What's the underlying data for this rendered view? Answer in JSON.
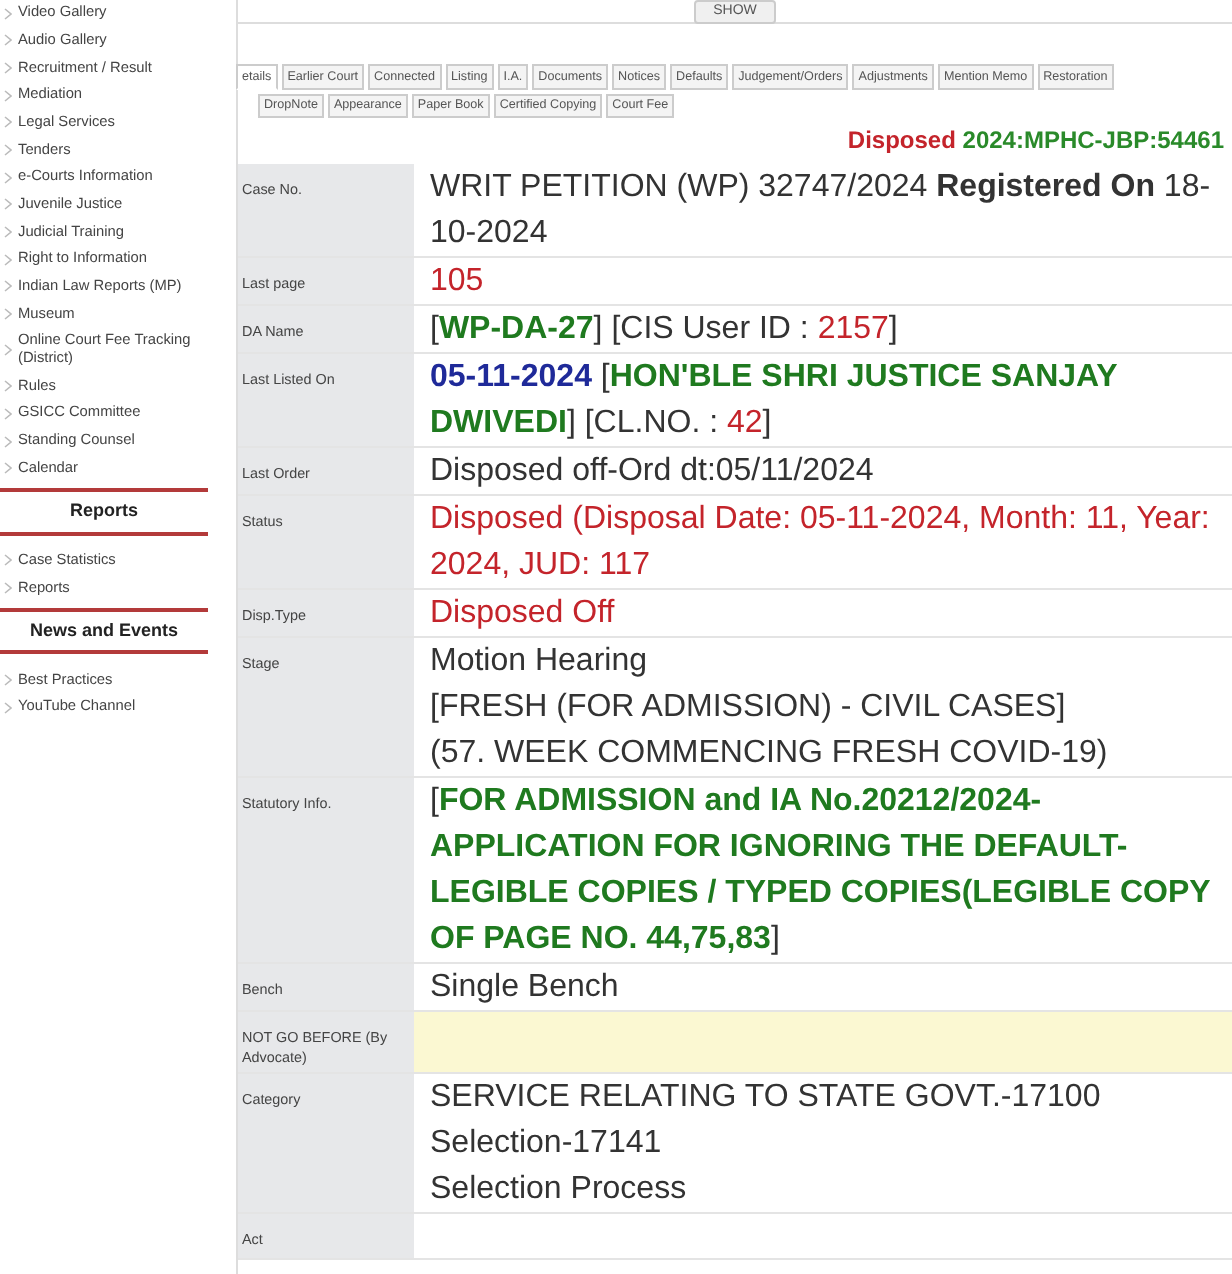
{
  "sidebar": {
    "sections": [
      {
        "items": [
          "Video Gallery",
          "Audio Gallery",
          "Recruitment / Result",
          "Mediation",
          "Legal Services",
          "Tenders",
          "e-Courts Information",
          "Juvenile Justice",
          "Judicial Training",
          "Right to Information",
          "Indian Law Reports (MP)",
          "Museum",
          "Online Court Fee Tracking (District)",
          "Rules",
          "GSICC Committee",
          "Standing Counsel",
          "Calendar"
        ]
      },
      {
        "heading": "Reports",
        "items": [
          "Case Statistics",
          "Reports"
        ]
      },
      {
        "heading": "News and Events",
        "items": [
          "Best Practices",
          "YouTube Channel"
        ]
      }
    ]
  },
  "show_button": "SHOW",
  "tabs": [
    {
      "label": "etails",
      "selected": true
    },
    {
      "label": "Earlier Court",
      "selected": false
    },
    {
      "label": "Connected",
      "selected": false
    },
    {
      "label": "Listing",
      "selected": false
    },
    {
      "label": "I.A.",
      "selected": false
    },
    {
      "label": "Documents",
      "selected": false
    },
    {
      "label": "Notices",
      "selected": false
    },
    {
      "label": "Defaults",
      "selected": false
    },
    {
      "label": "Judgement/Orders",
      "selected": false
    },
    {
      "label": "Adjustments",
      "selected": false
    },
    {
      "label": "Mention Memo",
      "selected": false
    },
    {
      "label": "Restoration",
      "selected": false
    },
    {
      "label": "DropNote",
      "selected": false
    },
    {
      "label": "Appearance",
      "selected": false
    },
    {
      "label": "Paper Book",
      "selected": false
    },
    {
      "label": "Certified Copying",
      "selected": false
    },
    {
      "label": "Court Fee",
      "selected": false
    }
  ],
  "case_header": [
    {
      "text": "Disposed",
      "color": "#c4242b"
    },
    {
      "text": "2024:MPHC-JBP:54461",
      "color": "#2a8a2a"
    }
  ],
  "details": [
    {
      "label": "Case No.",
      "highlighted": false,
      "lines": [
        [
          {
            "text": "WRIT PETITION (WP) 32747/2024 **Registered On** 18-10-2024",
            "color": "#333333",
            "bold": false
          }
        ]
      ]
    },
    {
      "label": "Last page",
      "highlighted": false,
      "lines": [
        [
          {
            "text": "105",
            "color": "#c4242b",
            "bold": false
          }
        ]
      ]
    },
    {
      "label": "DA Name",
      "highlighted": false,
      "lines": [
        [
          {
            "text": "[",
            "color": "#333333",
            "bold": false
          },
          {
            "text": "WP-DA-27",
            "color": "#1f7a1f",
            "bold": true
          },
          {
            "text": "] [CIS User ID : ",
            "color": "#333333",
            "bold": false
          },
          {
            "text": "2157",
            "color": "#c4242b",
            "bold": false
          },
          {
            "text": "]",
            "color": "#333333",
            "bold": false
          }
        ]
      ]
    },
    {
      "label": "Last Listed On",
      "highlighted": false,
      "lines": [
        [
          {
            "text": "05-11-2024",
            "color": "#1f2a99",
            "bold": true
          },
          {
            "text": " [",
            "color": "#333333",
            "bold": false
          },
          {
            "text": "HON'BLE SHRI JUSTICE SANJAY DWIVEDI",
            "color": "#1f7a1f",
            "bold": true
          },
          {
            "text": "] [CL.NO. : ",
            "color": "#333333",
            "bold": false
          },
          {
            "text": "42",
            "color": "#c4242b",
            "bold": false
          },
          {
            "text": "]",
            "color": "#333333",
            "bold": false
          }
        ]
      ]
    },
    {
      "label": "Last Order",
      "highlighted": false,
      "lines": [
        [
          {
            "text": "Disposed off-Ord dt:05/11/2024",
            "color": "#333333",
            "bold": false
          }
        ]
      ]
    },
    {
      "label": "Status",
      "highlighted": false,
      "lines": [
        [
          {
            "text": "Disposed (Disposal Date: 05-11-2024, Month: 11, Year: 2024, JUD: 117",
            "color": "#c4242b",
            "bold": false
          }
        ]
      ]
    },
    {
      "label": "Disp.Type",
      "highlighted": false,
      "lines": [
        [
          {
            "text": "Disposed Off",
            "color": "#c4242b",
            "bold": false
          }
        ]
      ]
    },
    {
      "label": "Stage",
      "highlighted": false,
      "lines": [
        [
          {
            "text": "Motion Hearing",
            "color": "#333333",
            "bold": false
          }
        ],
        [
          {
            "text": "[FRESH (FOR ADMISSION) - CIVIL CASES]",
            "color": "#333333",
            "bold": false
          }
        ],
        [
          {
            "text": "(57. WEEK COMMENCING FRESH COVID-19)",
            "color": "#333333",
            "bold": false
          }
        ]
      ]
    },
    {
      "label": "Statutory Info.",
      "highlighted": false,
      "lines": [
        [
          {
            "text": "[",
            "color": "#333333",
            "bold": false
          },
          {
            "text": "FOR ADMISSION and IA No.20212/2024-APPLICATION FOR IGNORING THE DEFAULT-LEGIBLE COPIES / TYPED COPIES(LEGIBLE COPY OF PAGE NO. 44,75,83",
            "color": "#1f7a1f",
            "bold": true
          },
          {
            "text": "]",
            "color": "#333333",
            "bold": false
          }
        ]
      ]
    },
    {
      "label": "Bench",
      "highlighted": false,
      "lines": [
        [
          {
            "text": "Single Bench",
            "color": "#333333",
            "bold": false
          }
        ]
      ]
    },
    {
      "label": "NOT GO BEFORE (By Advocate)",
      "highlighted": true
    },
    {
      "label": "Category",
      "highlighted": false,
      "lines": [
        [
          {
            "text": "SERVICE RELATING TO STATE GOVT.-17100",
            "color": "#333333",
            "bold": false
          }
        ],
        [
          {
            "text": "Selection-17141",
            "color": "#333333",
            "bold": false
          }
        ],
        [
          {
            "text": "Selection Process",
            "color": "#333333",
            "bold": false
          }
        ]
      ]
    },
    {
      "label": "Act",
      "highlighted": false
    }
  ]
}
